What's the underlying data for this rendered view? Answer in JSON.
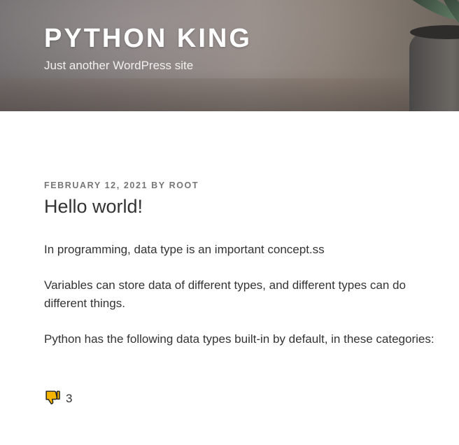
{
  "header": {
    "site_title": "PYTHON KING",
    "tagline": "Just another WordPress site",
    "colors": {
      "title": "#ffffff",
      "tagline": "#f2f0ee"
    }
  },
  "post": {
    "meta": {
      "date": "FEBRUARY 12, 2021",
      "by": "BY",
      "author": "ROOT"
    },
    "title": "Hello world!",
    "paragraphs": [
      "In programming, data type is an important concept.ss",
      "Variables can store data of different types, and different types can do different things.",
      "Python has the following data types built-in by default, in these categories:"
    ],
    "reaction": {
      "icon": "thumbs-down-icon",
      "count": "3",
      "color": "#f5b400"
    }
  }
}
